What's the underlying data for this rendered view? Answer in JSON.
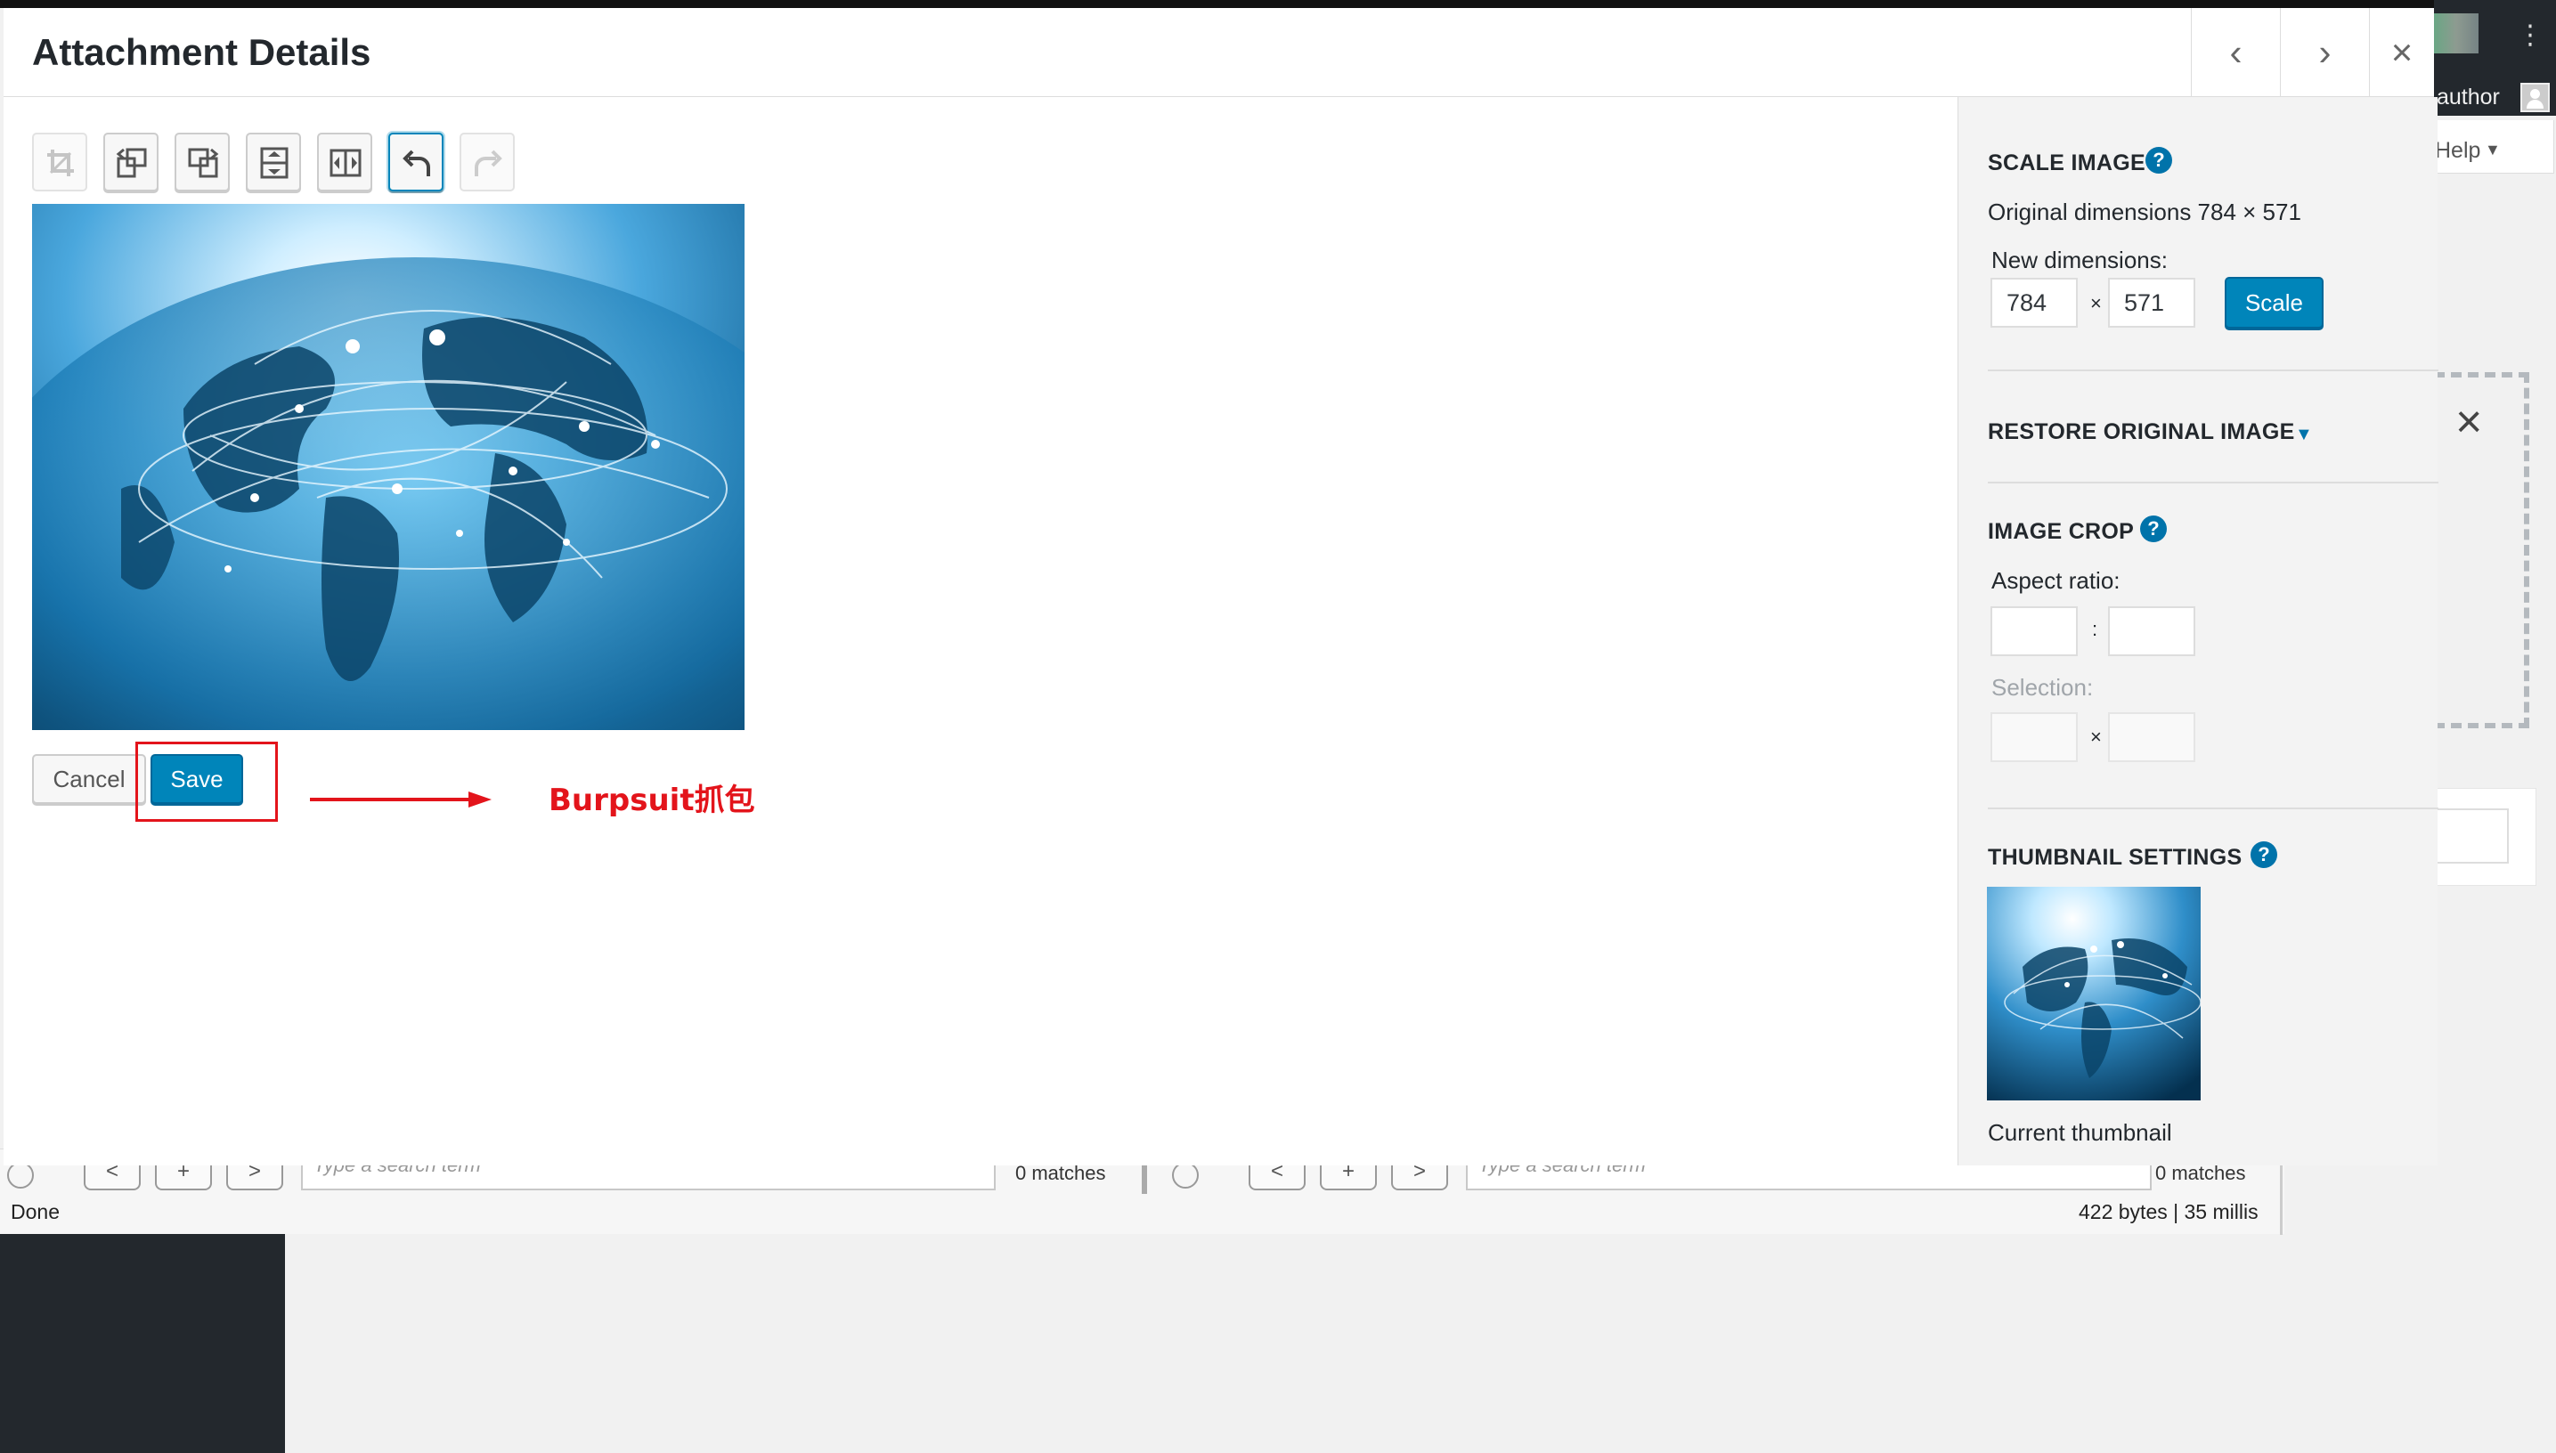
{
  "modal": {
    "title": "Attachment Details",
    "prev_icon": "‹",
    "next_icon": "›",
    "close_icon": "×"
  },
  "toolbar": {
    "tools": [
      "crop-icon",
      "rotate-left-icon",
      "rotate-right-icon",
      "flip-vertical-icon",
      "flip-horizontal-icon",
      "undo-icon",
      "redo-icon"
    ]
  },
  "actions": {
    "cancel_label": "Cancel",
    "save_label": "Save"
  },
  "annotation": {
    "text": "Burpsuit抓包",
    "color": "#e3141b"
  },
  "sidebar": {
    "scale": {
      "title": "SCALE IMAGE",
      "original": "Original dimensions 784 × 571",
      "new_label": "New dimensions:",
      "width": "784",
      "height": "571",
      "times": "×",
      "button": "Scale"
    },
    "restore": {
      "title": "RESTORE ORIGINAL IMAGE",
      "caret": "▼"
    },
    "crop": {
      "title": "IMAGE CROP",
      "aspect_label": "Aspect ratio:",
      "colon": ":",
      "selection_label": "Selection:",
      "times": "×"
    },
    "thumbnail": {
      "title": "THUMBNAIL SETTINGS",
      "caption": "Current thumbnail"
    },
    "help_glyph": "?"
  },
  "background": {
    "author": "author",
    "help_label": "Help",
    "help_caret": "▼",
    "kebab": "⋮",
    "dismiss": "×"
  },
  "burp": {
    "search_placeholder": "Type a search term",
    "matches_left": "0 matches",
    "matches_right": "0 matches",
    "status": "Done",
    "stats": "422 bytes | 35 millis",
    "nav_prev": "<",
    "nav_add": "+",
    "nav_next": ">"
  },
  "colors": {
    "accent": "#0085ba",
    "accent_dark": "#006799",
    "help_blue": "#0073aa",
    "annotation_red": "#e3141b"
  }
}
